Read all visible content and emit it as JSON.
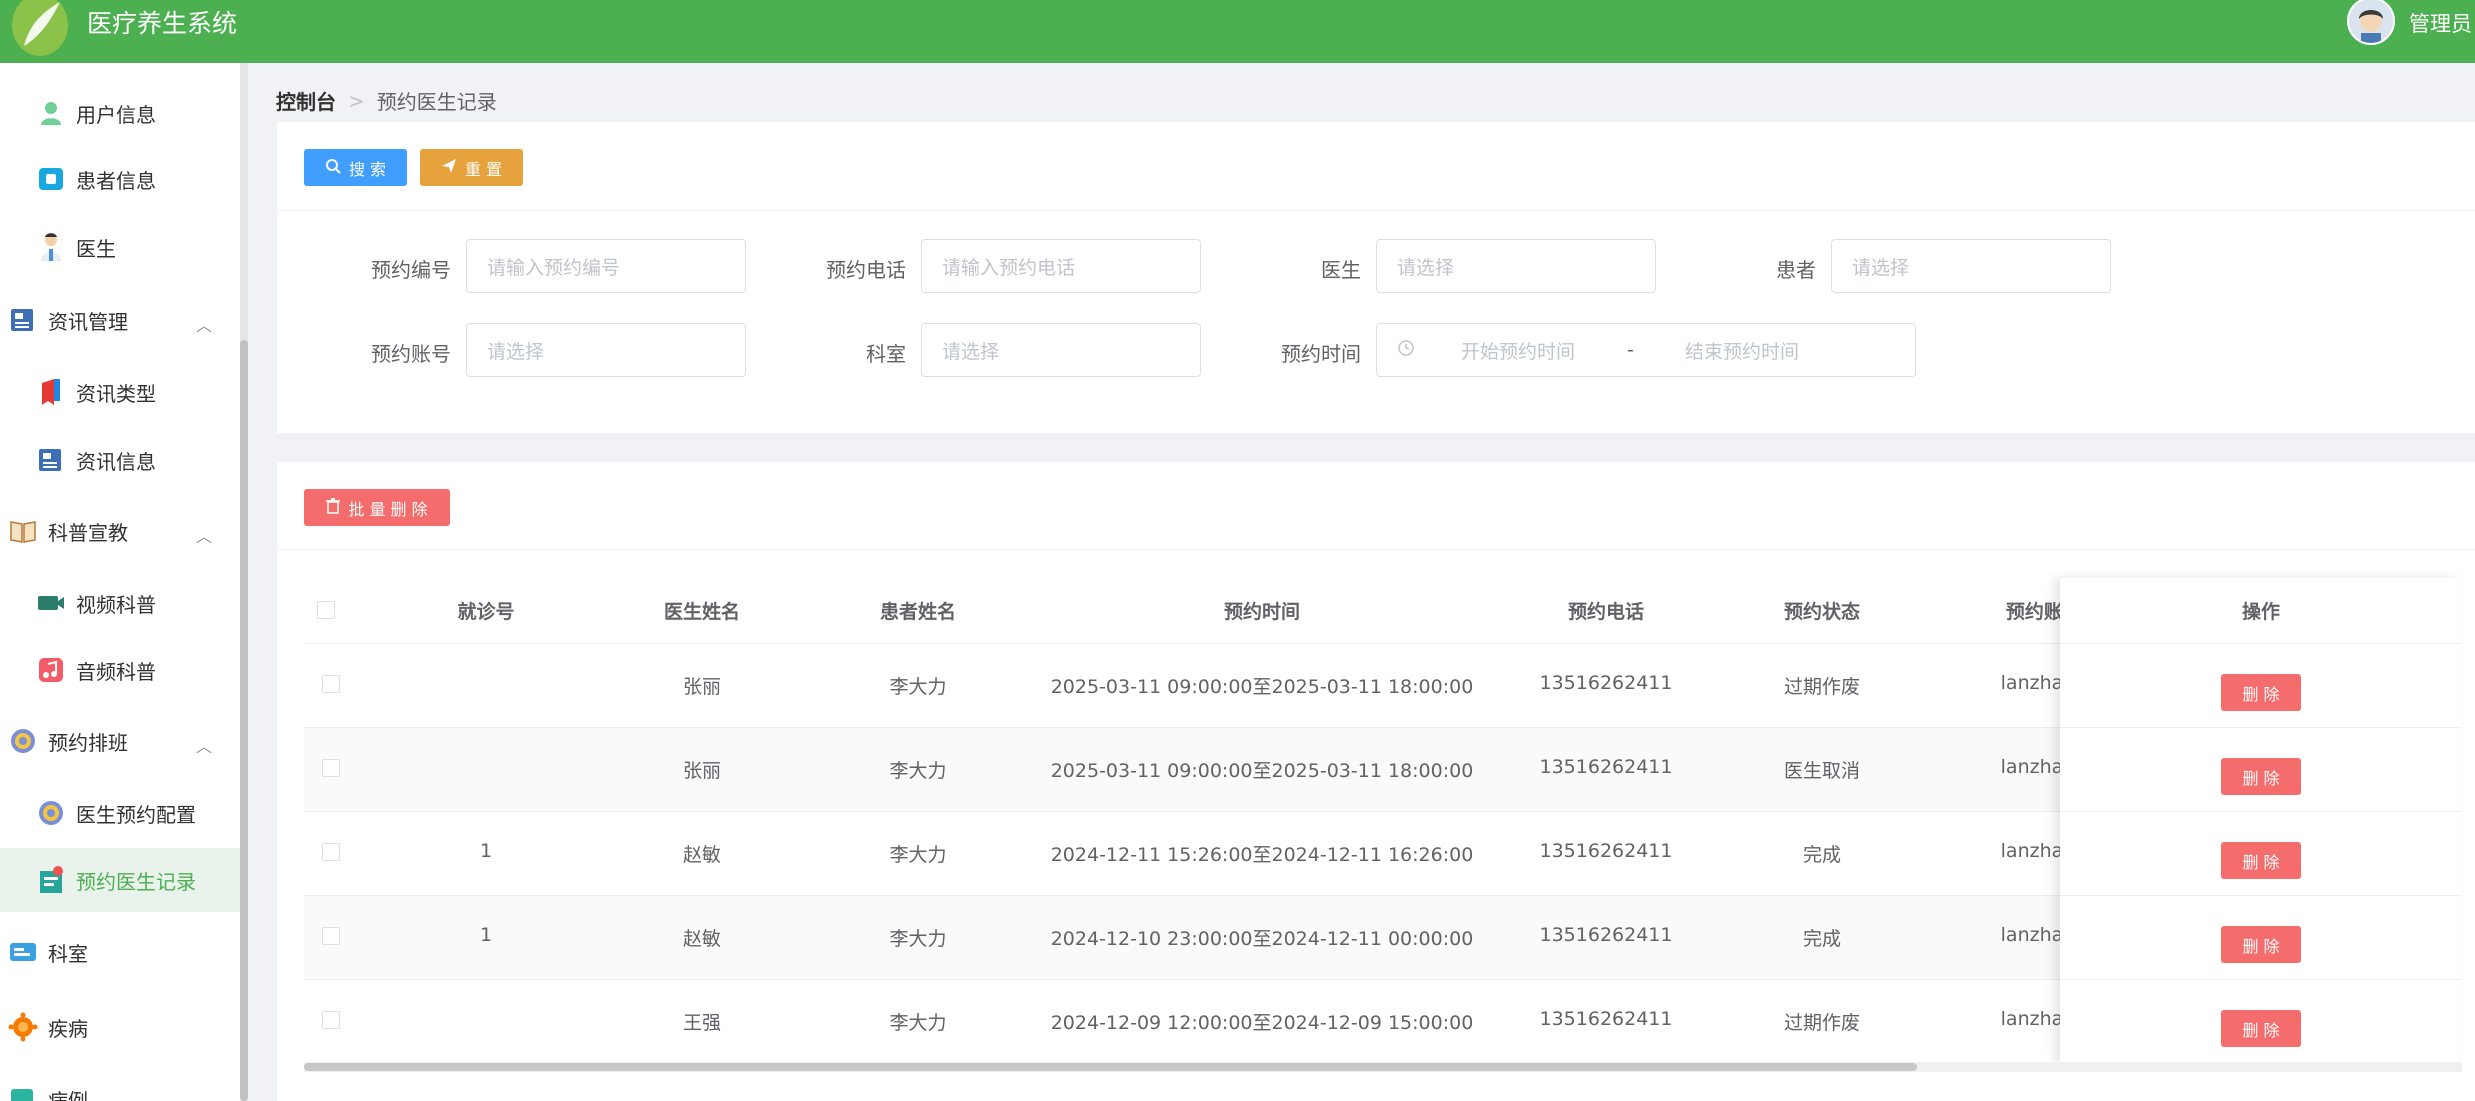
{
  "header": {
    "title": "医疗养生系统",
    "user": "管理员"
  },
  "colors": {
    "brand": "#4caf50",
    "primary": "#409eff",
    "warning": "#e6a23c",
    "danger": "#f56c6c"
  },
  "sidebar": {
    "items": [
      {
        "label": "用户信息",
        "icon": "user-icon"
      },
      {
        "label": "患者信息",
        "icon": "id-card-icon"
      },
      {
        "label": "医生",
        "icon": "doctor-icon"
      },
      {
        "label": "资讯管理",
        "icon": "newspaper-icon"
      },
      {
        "label": "资讯类型",
        "icon": "bookmark-icon"
      },
      {
        "label": "资讯信息",
        "icon": "news-icon"
      },
      {
        "label": "科普宣教",
        "icon": "book-icon"
      },
      {
        "label": "视频科普",
        "icon": "video-icon"
      },
      {
        "label": "音频科普",
        "icon": "music-icon"
      },
      {
        "label": "预约排班",
        "icon": "gear-icon"
      },
      {
        "label": "医生预约配置",
        "icon": "gear-icon"
      },
      {
        "label": "预约医生记录",
        "icon": "appointment-icon"
      },
      {
        "label": "科室",
        "icon": "department-icon"
      },
      {
        "label": "疾病",
        "icon": "virus-icon"
      },
      {
        "label": "病例",
        "icon": "record-icon"
      }
    ]
  },
  "breadcrumb": {
    "home": "控制台",
    "sep": ">",
    "current": "预约医生记录"
  },
  "toolbar": {
    "search": "搜 索",
    "reset": "重 置",
    "batch_delete": "批 量 删 除"
  },
  "search_form": {
    "appt_no": {
      "label": "预约编号",
      "placeholder": "请输入预约编号"
    },
    "appt_phone": {
      "label": "预约电话",
      "placeholder": "请输入预约电话"
    },
    "doctor": {
      "label": "医生",
      "placeholder": "请选择"
    },
    "patient": {
      "label": "患者",
      "placeholder": "请选择"
    },
    "appt_account": {
      "label": "预约账号",
      "placeholder": "请选择"
    },
    "dept": {
      "label": "科室",
      "placeholder": "请选择"
    },
    "appt_time": {
      "label": "预约时间",
      "start": "开始预约时间",
      "sep": "-",
      "end": "结束预约时间"
    }
  },
  "table": {
    "headers": [
      "就诊号",
      "医生姓名",
      "患者姓名",
      "预约时间",
      "预约电话",
      "预约状态",
      "预约账·",
      "操作"
    ],
    "delete_label": "删 除",
    "rows": [
      {
        "visit_no": "",
        "doctor": "张丽",
        "patient": "李大力",
        "time": "2025-03-11 09:00:00至2025-03-11 18:00:00",
        "phone": "13516262411",
        "status": "过期作废",
        "account": "lanzhan"
      },
      {
        "visit_no": "",
        "doctor": "张丽",
        "patient": "李大力",
        "time": "2025-03-11 09:00:00至2025-03-11 18:00:00",
        "phone": "13516262411",
        "status": "医生取消",
        "account": "lanzhan"
      },
      {
        "visit_no": "1",
        "doctor": "赵敏",
        "patient": "李大力",
        "time": "2024-12-11 15:26:00至2024-12-11 16:26:00",
        "phone": "13516262411",
        "status": "完成",
        "account": "lanzhan"
      },
      {
        "visit_no": "1",
        "doctor": "赵敏",
        "patient": "李大力",
        "time": "2024-12-10 23:00:00至2024-12-11 00:00:00",
        "phone": "13516262411",
        "status": "完成",
        "account": "lanzhan"
      },
      {
        "visit_no": "",
        "doctor": "王强",
        "patient": "李大力",
        "time": "2024-12-09 12:00:00至2024-12-09 15:00:00",
        "phone": "13516262411",
        "status": "过期作废",
        "account": "lanzhan"
      }
    ]
  }
}
